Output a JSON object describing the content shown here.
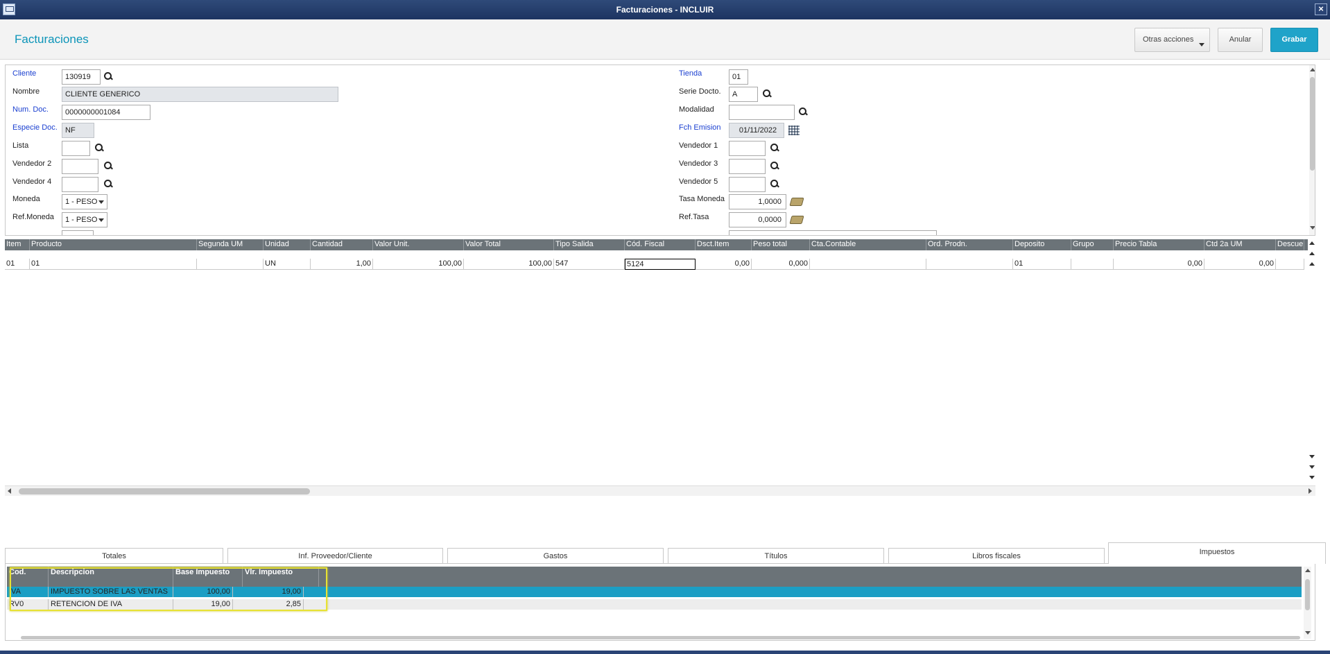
{
  "window": {
    "title": "Facturaciones - INCLUIR",
    "close": "×"
  },
  "header": {
    "title": "Facturaciones",
    "otras_acciones": "Otras acciones",
    "anular": "Anular",
    "grabar": "Grabar"
  },
  "form": {
    "cliente": {
      "label": "Cliente",
      "value": "130919"
    },
    "nombre": {
      "label": "Nombre",
      "value": "CLIENTE GENERICO"
    },
    "num_doc": {
      "label": "Num. Doc.",
      "value": "0000000001084"
    },
    "especie_doc": {
      "label": "Especie Doc.",
      "value": "NF"
    },
    "lista": {
      "label": "Lista",
      "value": ""
    },
    "vendedor2": {
      "label": "Vendedor 2",
      "value": ""
    },
    "vendedor4": {
      "label": "Vendedor 4",
      "value": ""
    },
    "moneda": {
      "label": "Moneda",
      "value": "1 - PESO"
    },
    "ref_moneda": {
      "label": "Ref.Moneda",
      "value": "1 - PESO"
    },
    "tienda": {
      "label": "Tienda",
      "value": "01"
    },
    "serie_docto": {
      "label": "Serie Docto.",
      "value": "A"
    },
    "modalidad": {
      "label": "Modalidad",
      "value": ""
    },
    "fch_emision": {
      "label": "Fch Emision",
      "value": "01/11/2022"
    },
    "vendedor1": {
      "label": "Vendedor 1",
      "value": ""
    },
    "vendedor3": {
      "label": "Vendedor 3",
      "value": ""
    },
    "vendedor5": {
      "label": "Vendedor 5",
      "value": ""
    },
    "tasa_moneda": {
      "label": "Tasa Moneda",
      "value": "1,0000"
    },
    "ref_tasa": {
      "label": "Ref.Tasa",
      "value": "0,0000"
    }
  },
  "items_grid": {
    "columns": [
      "Item",
      "Producto",
      "Segunda UM",
      "Unidad",
      "Cantidad",
      "Valor Unit.",
      "Valor Total",
      "Tipo Salida",
      "Cód. Fiscal",
      "Dsct.Item",
      "Peso total",
      "Cta.Contable",
      "Ord. Prodn.",
      "Deposito",
      "Grupo",
      "Precio Tabla",
      "Ctd 2a UM",
      "Descuento"
    ],
    "rows": [
      [
        "01",
        "01",
        "",
        "UN",
        "1,00",
        "100,00",
        "100,00",
        "547",
        "5124",
        "0,00",
        "0,000",
        "",
        "",
        "01",
        "",
        "0,00",
        "0,00",
        ""
      ]
    ]
  },
  "tabs": [
    "Totales",
    "Inf. Proveedor/Cliente",
    "Gastos",
    "Títulos",
    "Libros fiscales",
    "Impuestos"
  ],
  "active_tab": "Impuestos",
  "taxes": {
    "columns": [
      "Cod.",
      "Descripcion",
      "Base Impuesto",
      "Vlr. Impuesto"
    ],
    "rows": [
      [
        "IVA",
        "IMPUESTO SOBRE LAS VENTAS",
        "100,00",
        "19,00"
      ],
      [
        "RV0",
        "RETENCION DE IVA",
        "19,00",
        "2,85"
      ]
    ]
  },
  "colors": {
    "accent": "#1fa3c9",
    "selected_row": "#1b9ec4",
    "highlight": "#e8e233"
  }
}
